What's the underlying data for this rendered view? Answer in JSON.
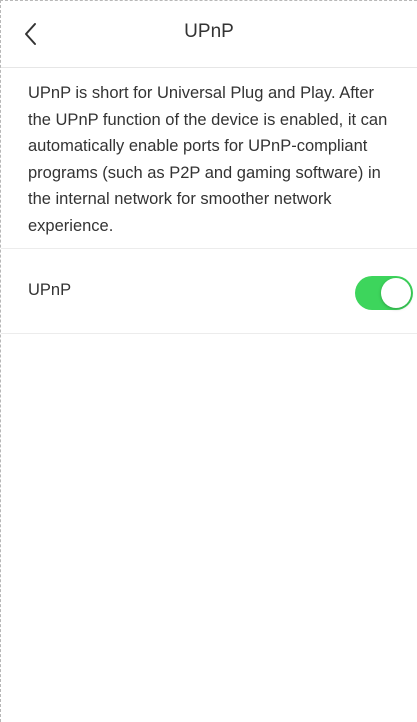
{
  "header": {
    "title": "UPnP",
    "back_icon": "chevron-left-icon"
  },
  "description": {
    "text": "UPnP is short for Universal Plug and Play. After the UPnP function of the device is enabled, it can automatically enable ports for UPnP-compliant programs (such as P2P and gaming software) in the internal network for smoother network experience."
  },
  "settings": {
    "upnp": {
      "label": "UPnP",
      "enabled": true,
      "toggle_on_color": "#3dd55c"
    }
  }
}
